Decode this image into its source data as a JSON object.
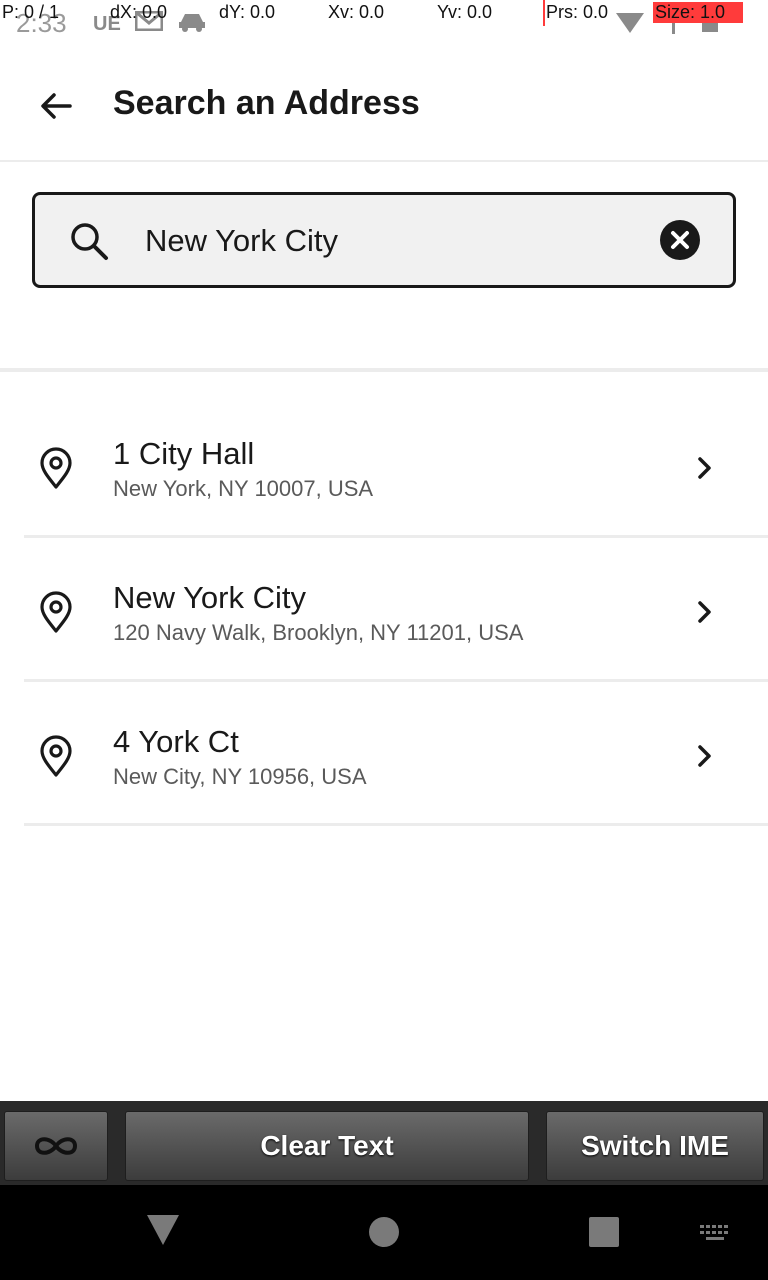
{
  "status_bar": {
    "time": "2:33",
    "left_icons": [
      "ue-icon",
      "mail-icon",
      "car-icon"
    ],
    "right_icons": [
      "wifi-icon",
      "signal-icon",
      "battery-icon"
    ]
  },
  "overlay": {
    "p": "P: 0 / 1",
    "dx": "dX: 0.0",
    "dy": "dY: 0.0",
    "xv": "Xv: 0.0",
    "yv": "Yv: 0.0",
    "prs": "Prs: 0.0",
    "size": "Size: 1.0"
  },
  "header": {
    "title": "Search an Address",
    "back_icon": "arrow-left-icon"
  },
  "search": {
    "value": "New York City",
    "placeholder": "",
    "clear_icon": "close-circle-icon"
  },
  "results": [
    {
      "title": "1 City Hall",
      "subtitle": "New York, NY 10007, USA"
    },
    {
      "title": "New York City",
      "subtitle": "120 Navy Walk, Brooklyn, NY 11201, USA"
    },
    {
      "title": "4 York Ct",
      "subtitle": "New City, NY 10956, USA"
    }
  ],
  "keyboard_bar": {
    "infinity_icon": "infinity-icon",
    "clear_text": "Clear Text",
    "switch_ime": "Switch IME"
  },
  "nav_bar": {
    "icons": [
      "back-triangle-icon",
      "home-circle-icon",
      "recents-square-icon",
      "keyboard-icon"
    ]
  },
  "colors": {
    "text": "#191919",
    "secondary_text": "#5a5a5a",
    "divider": "#ececec",
    "search_bg": "#f1f1f1",
    "overlay_red": "#ff3b3b"
  }
}
